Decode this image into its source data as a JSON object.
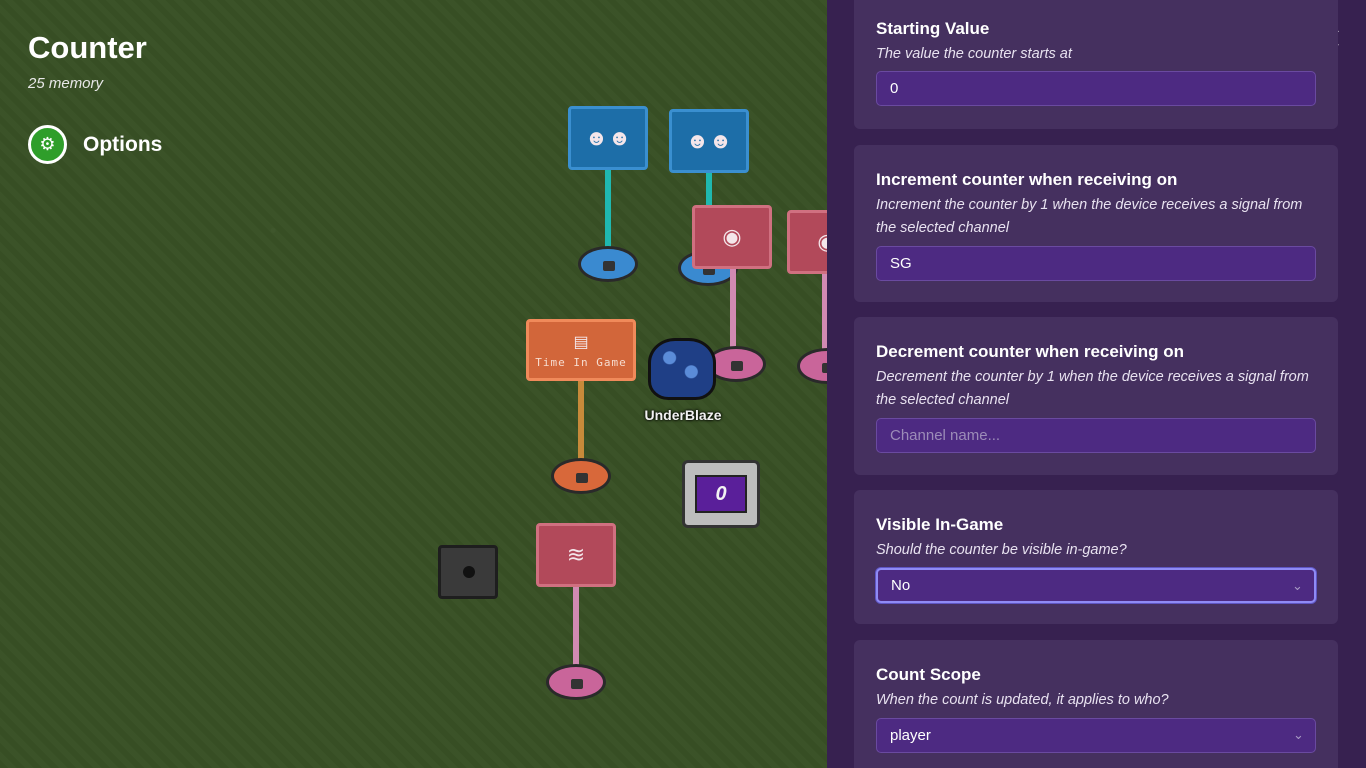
{
  "device": {
    "title": "Counter",
    "memory": "25 memory",
    "options_label": "Options",
    "options_icon": "gear-icon"
  },
  "world": {
    "player_name": "UnderBlaze",
    "sign_time_in_game": "Time In Game",
    "counter_display": "0"
  },
  "panel": {
    "close_icon": "close-icon",
    "fields": [
      {
        "title": "Starting Value",
        "description": "The value the counter starts at",
        "value": "0",
        "type": "input"
      },
      {
        "title": "Increment counter when receiving on",
        "description": "Increment the counter by 1 when the device receives a signal from the selected channel",
        "value": "SG",
        "type": "input"
      },
      {
        "title": "Decrement counter when receiving on",
        "description": "Decrement the counter by 1 when the device receives a signal from the selected channel",
        "value": "",
        "placeholder": "Channel name...",
        "type": "input"
      },
      {
        "title": "Visible In-Game",
        "description": "Should the counter be visible in-game?",
        "value": "No",
        "type": "select"
      },
      {
        "title": "Count Scope",
        "description": "When the count is updated, it applies to who?",
        "value": "player",
        "type": "select"
      }
    ]
  },
  "colors": {
    "panel_bg": "#372150",
    "card_bg": "#45305f",
    "field_bg": "#4d2a82",
    "options_green": "#2f9e2a",
    "grass": "#3e5829"
  }
}
